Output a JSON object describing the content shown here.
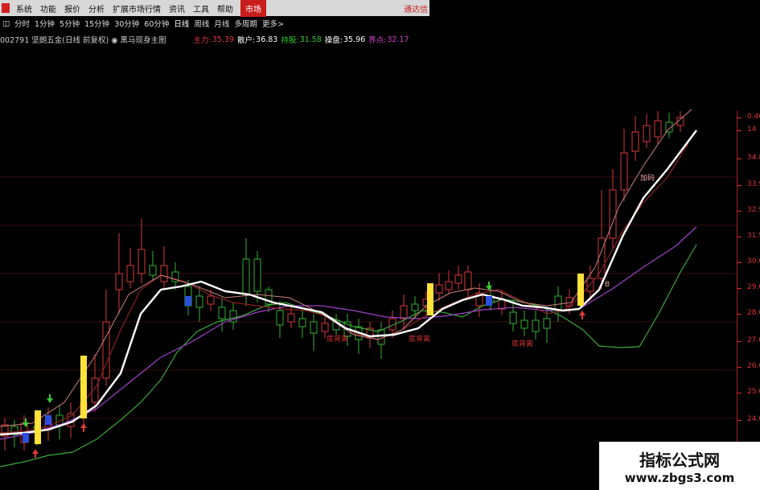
{
  "menubar": {
    "items": [
      "系统",
      "功能",
      "报价",
      "分析",
      "扩展市场行情",
      "资讯",
      "工具",
      "帮助"
    ],
    "market_tab": "市场",
    "right_text": "通达信"
  },
  "periods": {
    "lead": "◫",
    "items": [
      "分时",
      "1分钟",
      "5分钟",
      "15分钟",
      "30分钟",
      "60分钟",
      "日线",
      "周线",
      "月线",
      "多周期",
      "更多>"
    ]
  },
  "stock": {
    "title": "002791 坚朗五金(日线 前复权) ◉ 黑马现身主图",
    "indicators": [
      {
        "label": "主力:",
        "value": "35.39",
        "color": "#e23b3b"
      },
      {
        "label": "散户:",
        "value": "36.83",
        "color": "#ffffff"
      },
      {
        "label": "持股:",
        "value": "31.58",
        "color": "#33cc33"
      },
      {
        "label": "操盘:",
        "value": "35.96",
        "color": "#ffffff"
      },
      {
        "label": "界点:",
        "value": "32.17",
        "color": "#cc44cc"
      }
    ]
  },
  "annotations": {
    "bottom_deviation": "底背离",
    "accumulate": "加码",
    "buy": "B"
  },
  "yaxis": {
    "labels": [
      "0.40",
      "14",
      "34.8",
      "33.9",
      "32.9",
      "31.9",
      "30.0",
      "29.0",
      "28.0",
      "27.0",
      "26.0",
      "25.0",
      "24.0"
    ]
  },
  "colors": {
    "up": "#d63a3a",
    "down": "#33b033",
    "white_line": "#ffffff",
    "purple_line": "#a040c8",
    "green_line": "#3aa83a",
    "signal_bar": "#ffe23a",
    "blue_mark": "#2b50e0",
    "axis": "#d33333"
  },
  "watermark": {
    "line1": "指标公式网",
    "line2": "www.zbgs3.com"
  }
}
